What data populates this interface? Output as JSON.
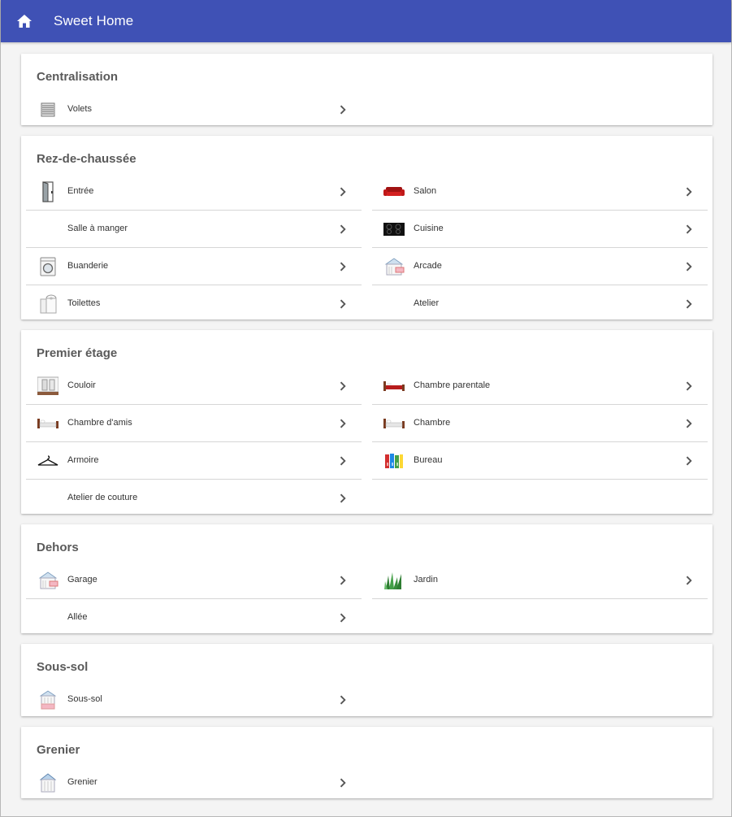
{
  "app": {
    "title": "Sweet Home",
    "home_icon": "home-icon"
  },
  "colors": {
    "appbar": "#3f51b5",
    "background": "#f4f4f4",
    "card": "#ffffff"
  },
  "sections": [
    {
      "id": "centralisation",
      "title": "Centralisation",
      "items": [
        {
          "id": "volets",
          "label": "Volets",
          "icon": "shutter-icon"
        }
      ]
    },
    {
      "id": "rdc",
      "title": "Rez-de-chaussée",
      "items": [
        {
          "id": "entree",
          "label": "Entrée",
          "icon": "door-icon"
        },
        {
          "id": "salon",
          "label": "Salon",
          "icon": "sofa-icon"
        },
        {
          "id": "salle-a-manger",
          "label": "Salle à manger",
          "icon": ""
        },
        {
          "id": "cuisine",
          "label": "Cuisine",
          "icon": "cooktop-icon"
        },
        {
          "id": "buanderie",
          "label": "Buanderie",
          "icon": "washing-machine-icon"
        },
        {
          "id": "arcade",
          "label": "Arcade",
          "icon": "house-icon"
        },
        {
          "id": "toilettes",
          "label": "Toilettes",
          "icon": "toilet-paper-icon"
        },
        {
          "id": "atelier",
          "label": "Atelier",
          "icon": ""
        }
      ]
    },
    {
      "id": "etage",
      "title": "Premier étage",
      "items": [
        {
          "id": "couloir",
          "label": "Couloir",
          "icon": "hallway-icon"
        },
        {
          "id": "chambre-parentale",
          "label": "Chambre parentale",
          "icon": "double-bed-icon"
        },
        {
          "id": "chambre-amis",
          "label": "Chambre d'amis",
          "icon": "bed-icon"
        },
        {
          "id": "chambre",
          "label": "Chambre",
          "icon": "bed-icon"
        },
        {
          "id": "armoire",
          "label": "Armoire",
          "icon": "hanger-icon"
        },
        {
          "id": "bureau",
          "label": "Bureau",
          "icon": "binders-icon"
        },
        {
          "id": "atelier-couture",
          "label": "Atelier de couture",
          "icon": ""
        }
      ]
    },
    {
      "id": "dehors",
      "title": "Dehors",
      "items": [
        {
          "id": "garage",
          "label": "Garage",
          "icon": "house-icon"
        },
        {
          "id": "jardin",
          "label": "Jardin",
          "icon": "grass-icon"
        },
        {
          "id": "allee",
          "label": "Allée",
          "icon": ""
        }
      ]
    },
    {
      "id": "sous-sol",
      "title": "Sous-sol",
      "items": [
        {
          "id": "sous-sol",
          "label": "Sous-sol",
          "icon": "house-basement-icon"
        }
      ]
    },
    {
      "id": "grenier",
      "title": "Grenier",
      "items": [
        {
          "id": "grenier",
          "label": "Grenier",
          "icon": "house-attic-icon"
        }
      ]
    }
  ]
}
